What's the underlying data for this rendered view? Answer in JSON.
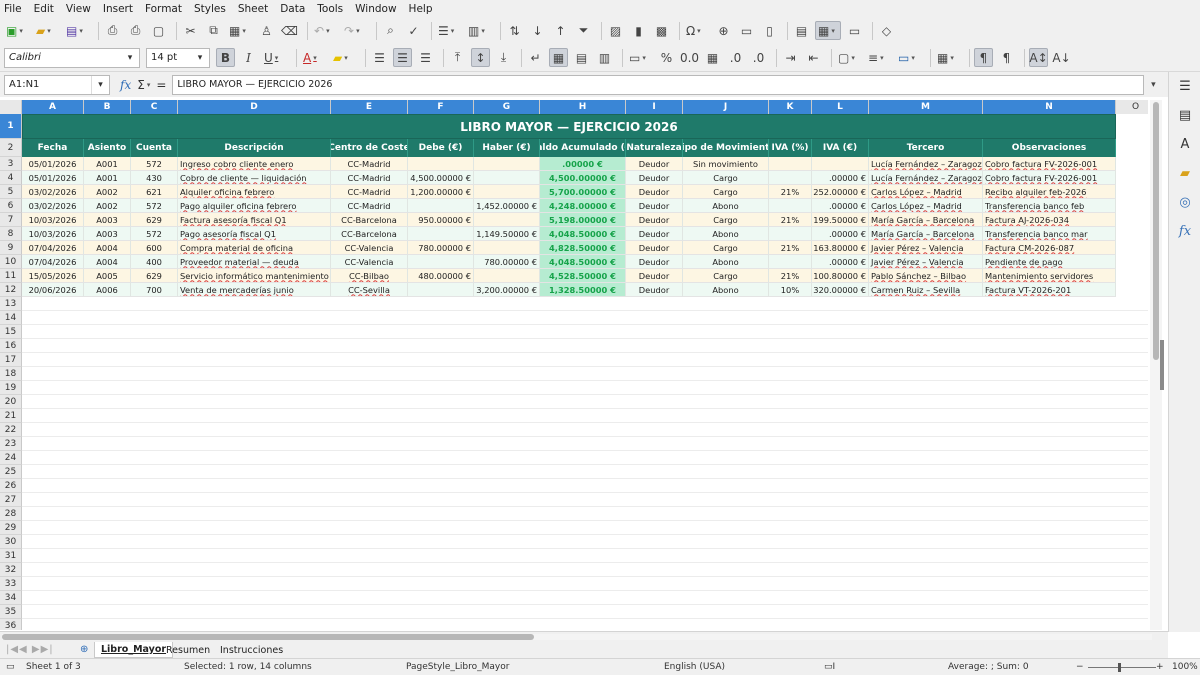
{
  "menubar": [
    "File",
    "Edit",
    "View",
    "Insert",
    "Format",
    "Styles",
    "Sheet",
    "Data",
    "Tools",
    "Window",
    "Help"
  ],
  "font": {
    "name": "Calibri",
    "size": "14 pt"
  },
  "formula_bar": {
    "cell_ref": "A1:N1",
    "content": "LIBRO MAYOR — EJERCICIO 2026",
    "fx": "fx",
    "sigma": "Σ",
    "equals": "="
  },
  "columns": [
    "A",
    "B",
    "C",
    "D",
    "E",
    "F",
    "G",
    "H",
    "I",
    "J",
    "K",
    "L",
    "M",
    "N",
    "O"
  ],
  "title": "LIBRO MAYOR — EJERCICIO 2026",
  "headers": [
    "Fecha",
    "Asiento",
    "Cuenta",
    "Descripción",
    "Centro de Coste",
    "Debe (€)",
    "Haber (€)",
    "Saldo Acumulado (€)",
    "Naturaleza",
    "Tipo de Movimiento",
    "IVA (%)",
    "IVA (€)",
    "Tercero",
    "Observaciones"
  ],
  "rows": [
    [
      "05/01/2026",
      "A001",
      "572",
      "Ingreso cobro cliente enero",
      "CC-Madrid",
      "",
      "",
      ".00000 €",
      "Deudor",
      "Sin movimiento",
      "",
      "",
      "Lucía Fernández – Zaragoza",
      "Cobro factura FV-2026-001"
    ],
    [
      "05/01/2026",
      "A001",
      "430",
      "Cobro de cliente — liquidación",
      "CC-Madrid",
      "4,500.00000 €",
      "",
      "4,500.00000 €",
      "Deudor",
      "Cargo",
      "",
      ".00000 €",
      "Lucía Fernández – Zaragoza",
      "Cobro factura FV-2026-001"
    ],
    [
      "03/02/2026",
      "A002",
      "621",
      "Alquiler oficina febrero",
      "CC-Madrid",
      "1,200.00000 €",
      "",
      "5,700.00000 €",
      "Deudor",
      "Cargo",
      "21%",
      "252.00000 €",
      "Carlos López – Madrid",
      "Recibo alquiler feb-2026"
    ],
    [
      "03/02/2026",
      "A002",
      "572",
      "Pago alquiler oficina febrero",
      "CC-Madrid",
      "",
      "1,452.00000 €",
      "4,248.00000 €",
      "Deudor",
      "Abono",
      "",
      ".00000 €",
      "Carlos López – Madrid",
      "Transferencia banco feb"
    ],
    [
      "10/03/2026",
      "A003",
      "629",
      "Factura asesoría fiscal Q1",
      "CC-Barcelona",
      "950.00000 €",
      "",
      "5,198.00000 €",
      "Deudor",
      "Cargo",
      "21%",
      "199.50000 €",
      "María García – Barcelona",
      "Factura AJ-2026-034"
    ],
    [
      "10/03/2026",
      "A003",
      "572",
      "Pago asesoría fiscal Q1",
      "CC-Barcelona",
      "",
      "1,149.50000 €",
      "4,048.50000 €",
      "Deudor",
      "Abono",
      "",
      ".00000 €",
      "María García – Barcelona",
      "Transferencia banco mar"
    ],
    [
      "07/04/2026",
      "A004",
      "600",
      "Compra material de oficina",
      "CC-Valencia",
      "780.00000 €",
      "",
      "4,828.50000 €",
      "Deudor",
      "Cargo",
      "21%",
      "163.80000 €",
      "Javier Pérez – Valencia",
      "Factura CM-2026-087"
    ],
    [
      "07/04/2026",
      "A004",
      "400",
      "Proveedor material — deuda",
      "CC-Valencia",
      "",
      "780.00000 €",
      "4,048.50000 €",
      "Deudor",
      "Abono",
      "",
      ".00000 €",
      "Javier Pérez – Valencia",
      "Pendiente de pago"
    ],
    [
      "15/05/2026",
      "A005",
      "629",
      "Servicio informático mantenimiento",
      "CC-Bilbao",
      "480.00000 €",
      "",
      "4,528.50000 €",
      "Deudor",
      "Cargo",
      "21%",
      "100.80000 €",
      "Pablo Sánchez – Bilbao",
      "Mantenimiento servidores"
    ],
    [
      "20/06/2026",
      "A006",
      "700",
      "Venta de mercaderías junio",
      "CC-Sevilla",
      "",
      "3,200.00000 €",
      "1,328.50000 €",
      "Deudor",
      "Abono",
      "10%",
      "320.00000 €",
      "Carmen Ruiz – Sevilla",
      "Factura VT-2026-201"
    ]
  ],
  "row_numbers": [
    "1",
    "2",
    "3",
    "4",
    "5",
    "6",
    "7",
    "8",
    "9",
    "10",
    "11",
    "12",
    "13",
    "14",
    "15",
    "16",
    "17",
    "18",
    "19",
    "20",
    "21",
    "22",
    "23",
    "24",
    "25",
    "26",
    "27",
    "28",
    "29",
    "30",
    "31",
    "32",
    "33",
    "34",
    "35",
    "36"
  ],
  "sheets": [
    "Libro_Mayor",
    "Resumen",
    "Instrucciones"
  ],
  "status": {
    "sheet": "Sheet 1 of 3",
    "selection": "Selected: 1 row, 14 columns",
    "page_style": "PageStyle_Libro_Mayor",
    "language": "English (USA)",
    "calc": "Average: ; Sum: 0",
    "zoom": "100%"
  }
}
